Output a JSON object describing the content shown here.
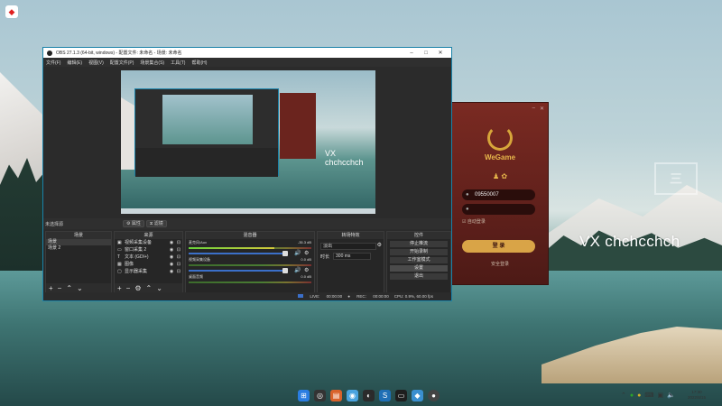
{
  "wallpaper": {
    "name": "landscape"
  },
  "desktop": {
    "icon": "app-shortcut-icon"
  },
  "watermark": {
    "text": "VX chchcchch",
    "box_text": "三"
  },
  "wegame": {
    "logo_text": "WeGame",
    "account_value": "09550007",
    "password_value": "",
    "remember_label": "自动登录",
    "login_label": "登 录",
    "footer_text": "安全登录"
  },
  "obs": {
    "title": "OBS 27.1.3 (64-bit, windows) - 配置文件: 未命名 - 场景: 未命名",
    "menu": [
      "文件(F)",
      "编辑(E)",
      "视图(V)",
      "配置文件(P)",
      "场景集合(S)",
      "工具(T)",
      "帮助(H)"
    ],
    "no_source_selected": "未选择源",
    "properties_btn": "属性",
    "filters_btn": "滤镜",
    "preview_watermark": "VX chchcchch",
    "docks": {
      "scenes": {
        "title": "场景",
        "items": [
          "场景",
          "场景 2"
        ]
      },
      "sources": {
        "title": "来源",
        "items": [
          {
            "icon": "camera-icon",
            "label": "视频采集设备"
          },
          {
            "icon": "window-icon",
            "label": "窗口采集 2"
          },
          {
            "icon": "text-icon",
            "label": "文本 (GDI+)"
          },
          {
            "icon": "image-icon",
            "label": "图像"
          },
          {
            "icon": "monitor-icon",
            "label": "显示器采集"
          }
        ]
      },
      "mixer": {
        "title": "混音器",
        "channels": [
          {
            "name": "麦克风/Aux",
            "db": "-35.3 dB",
            "level": 0.7
          },
          {
            "name": "视频采集设备",
            "db": "0.0 dB",
            "level": 0
          },
          {
            "name": "桌面音频",
            "db": "0.0 dB",
            "level": 0
          }
        ]
      },
      "transitions": {
        "title": "转场特效",
        "type": "淡出",
        "duration_label": "时长",
        "duration_value": "300 ms"
      },
      "controls": {
        "title": "控件",
        "buttons": [
          "停止推流",
          "开始录制",
          "工作室模式",
          "设置",
          "退出"
        ]
      }
    },
    "status": {
      "live_label": "LIVE:",
      "live_time": "00:00:00",
      "rec_label": "REC:",
      "rec_time": "00:00:00",
      "cpu": "CPU: 0.9%, 60.00 fps"
    }
  },
  "taskbar": {
    "apps": [
      "windows-icon",
      "chrome-icon",
      "store-icon",
      "app-icon",
      "app-icon",
      "app-icon",
      "app-icon",
      "app-icon",
      "obs-icon"
    ],
    "time": "17:30",
    "date": "2022/8/15"
  }
}
